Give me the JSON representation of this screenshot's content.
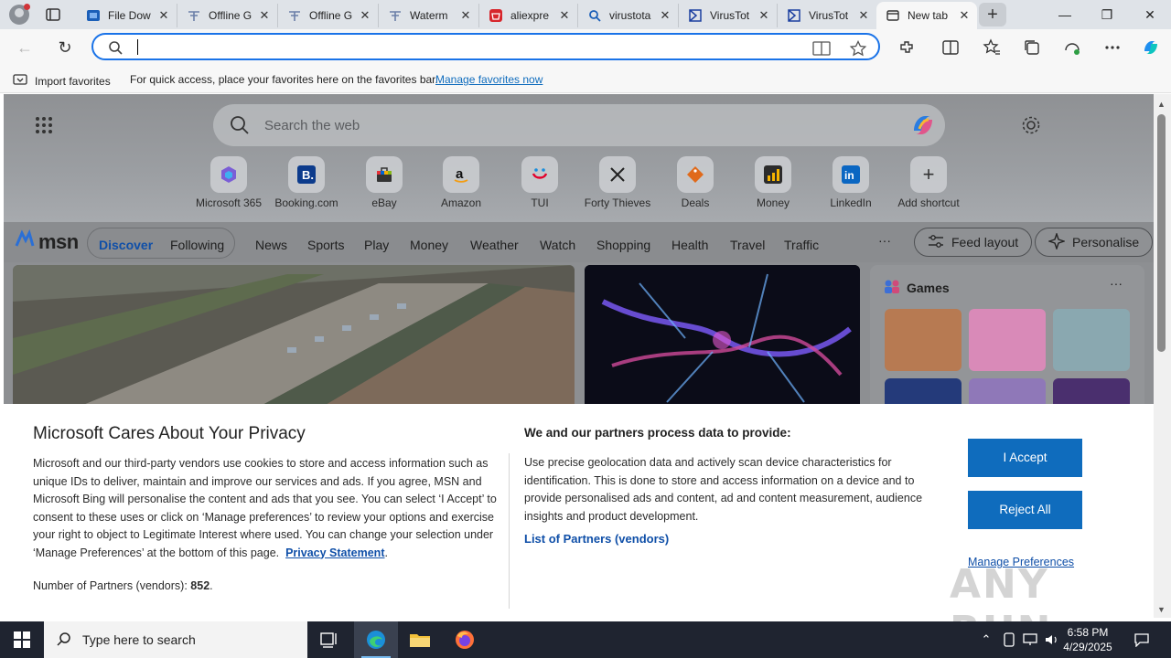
{
  "browser": {
    "tabs": [
      {
        "label": "File Dow",
        "icon": "file-icon"
      },
      {
        "label": "Offline G",
        "icon": "blog-icon"
      },
      {
        "label": "Offline G",
        "icon": "blog-icon"
      },
      {
        "label": "Waterm",
        "icon": "blog-icon"
      },
      {
        "label": "aliexpre",
        "icon": "aliexpress-icon"
      },
      {
        "label": "virustota",
        "icon": "search-icon"
      },
      {
        "label": "VirusTot",
        "icon": "virustotal-icon"
      },
      {
        "label": "VirusTot",
        "icon": "virustotal-icon"
      },
      {
        "label": "New tab",
        "icon": "newtab-icon",
        "active": true
      }
    ],
    "address": {
      "value": "",
      "placeholder": ""
    },
    "favorites_bar": {
      "import_label": "Import favorites",
      "message": "For quick access, place your favorites here on the favorites bar.",
      "link": "Manage favorites now"
    }
  },
  "newtab": {
    "search_placeholder": "Search the web",
    "shortcuts": [
      {
        "label": "Microsoft 365"
      },
      {
        "label": "Booking.com"
      },
      {
        "label": "eBay"
      },
      {
        "label": "Amazon"
      },
      {
        "label": "TUI"
      },
      {
        "label": "Forty Thieves"
      },
      {
        "label": "Deals"
      },
      {
        "label": "Money"
      },
      {
        "label": "LinkedIn"
      },
      {
        "label": "Add shortcut"
      }
    ],
    "msn": {
      "logo": "msn",
      "nav": [
        "Discover",
        "Following",
        "News",
        "Sports",
        "Play",
        "Money",
        "Weather",
        "Watch",
        "Shopping",
        "Health",
        "Travel",
        "Traffic"
      ],
      "more": "···",
      "feed_layout": "Feed layout",
      "personalise": "Personalise"
    },
    "games": {
      "title": "Games",
      "more": "···"
    }
  },
  "privacy": {
    "title": "Microsoft Cares About Your Privacy",
    "body": "Microsoft and our third-party vendors use cookies to store and access information such as unique IDs to deliver, maintain and improve our services and ads. If you agree, MSN and Microsoft Bing will personalise the content and ads that you see. You can select ‘I Accept’ to consent to these uses or click on ‘Manage preferences’ to review your options and exercise your right to object to Legitimate Interest where used.  You can change your selection under ‘Manage Preferences’ at the bottom of this page.",
    "privacy_link": "Privacy Statement",
    "partners_label": "Number of Partners (vendors):",
    "partners_count": "852",
    "right_title": "We and our partners process data to provide:",
    "right_body": "Use precise geolocation data and actively scan device characteristics for identification. This is done to store and access information on a device and to provide personalised ads and content, ad and content measurement, audience insights and product development.",
    "vendors_link": "List of Partners (vendors)",
    "accept": "I Accept",
    "reject": "Reject All",
    "manage": "Manage Preferences"
  },
  "watermark": "ANY RUN",
  "taskbar": {
    "search_placeholder": "Type here to search",
    "time": "6:58 PM",
    "date": "4/29/2025"
  },
  "colors": {
    "accent": "#0f6cbd",
    "taskbar": "#1f2430"
  }
}
